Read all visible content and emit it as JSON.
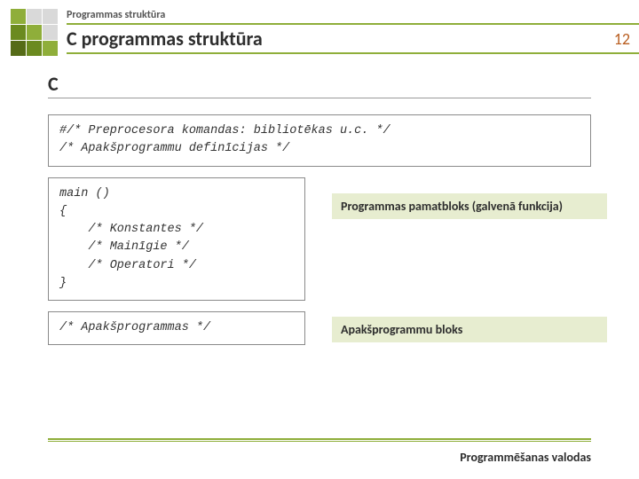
{
  "header": {
    "breadcrumb": "Programmas struktūra",
    "title": "C programmas struktūra",
    "page_number": "12"
  },
  "section": {
    "label": "C"
  },
  "blocks": {
    "preproc": "#/* Preprocesora komandas: bibliotēkas u.c. */\n/* Apakšprogrammu definīcijas */",
    "main_code": "main ()\n{\n    /* Konstantes */\n    /* Mainīgie */\n    /* Operatori */\n}",
    "main_callout": "Programmas pamatbloks (galvenā funkcija)",
    "sub_code": "/* Apakšprogrammas */",
    "sub_callout": "Apakšprogrammu bloks"
  },
  "footer": {
    "text": "Programmēšanas valodas"
  }
}
